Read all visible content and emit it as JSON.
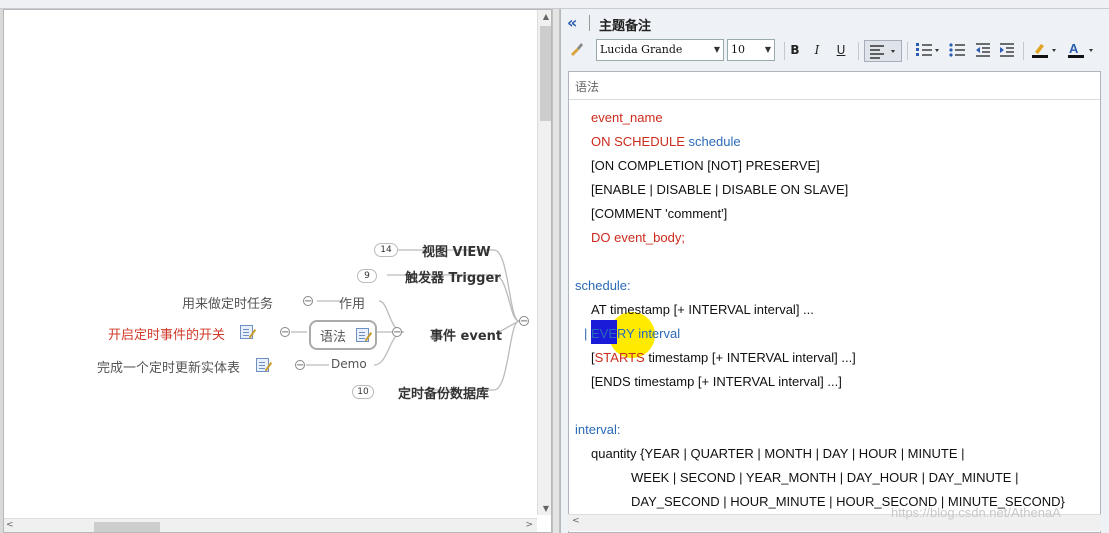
{
  "mindmap": {
    "nodes": {
      "view": {
        "label": "视图  VIEW",
        "count": "14"
      },
      "trigger": {
        "label": "触发器 Trigger",
        "count": "9"
      },
      "event": {
        "label": "事件 event"
      },
      "backup": {
        "label": "定时备份数据库",
        "count": "10"
      },
      "usage": {
        "label": "作用"
      },
      "syntax": {
        "label": "语法"
      },
      "demo": {
        "label": "Demo"
      },
      "usage_child": {
        "label": "用来做定时任务"
      },
      "syntax_child": {
        "label": "开启定时事件的开关"
      },
      "demo_child": {
        "label": "完成一个定时更新实体表"
      }
    }
  },
  "notes_panel": {
    "title": "主题备注",
    "toolbar": {
      "font_name": "Lucida Grande",
      "font_size": "10",
      "bold": "B",
      "italic": "I",
      "underline": "U"
    },
    "subject": "语法",
    "lines": {
      "l1": "event_name",
      "l2a": "ON SCHEDULE ",
      "l2b": "schedule",
      "l3": "[ON COMPLETION [NOT] PRESERVE]",
      "l4": "[ENABLE | DISABLE | DISABLE ON SLAVE]",
      "l5": "[COMMENT 'comment']",
      "l6": "DO event_body;",
      "l7": "schedule:",
      "l8": "AT timestamp [+ INTERVAL interval] ...",
      "l9a": "| EVERY",
      "l9b": " interval",
      "l10a": "[",
      "l10b": "STARTS",
      "l10c": " timestamp [+ INTERVAL interval] ...]",
      "l11": "[ENDS timestamp [+ INTERVAL interval] ...]",
      "l12": "interval:",
      "l13": "quantity {YEAR | QUARTER | MONTH | DAY | HOUR | MINUTE |",
      "l14": "WEEK | SECOND | YEAR_MONTH | DAY_HOUR | DAY_MINUTE |",
      "l15": "DAY_SECOND | HOUR_MINUTE | HOUR_SECOND | MINUTE_SECOND}"
    },
    "watermark": "https://blog.csdn.net/AthenaA"
  }
}
